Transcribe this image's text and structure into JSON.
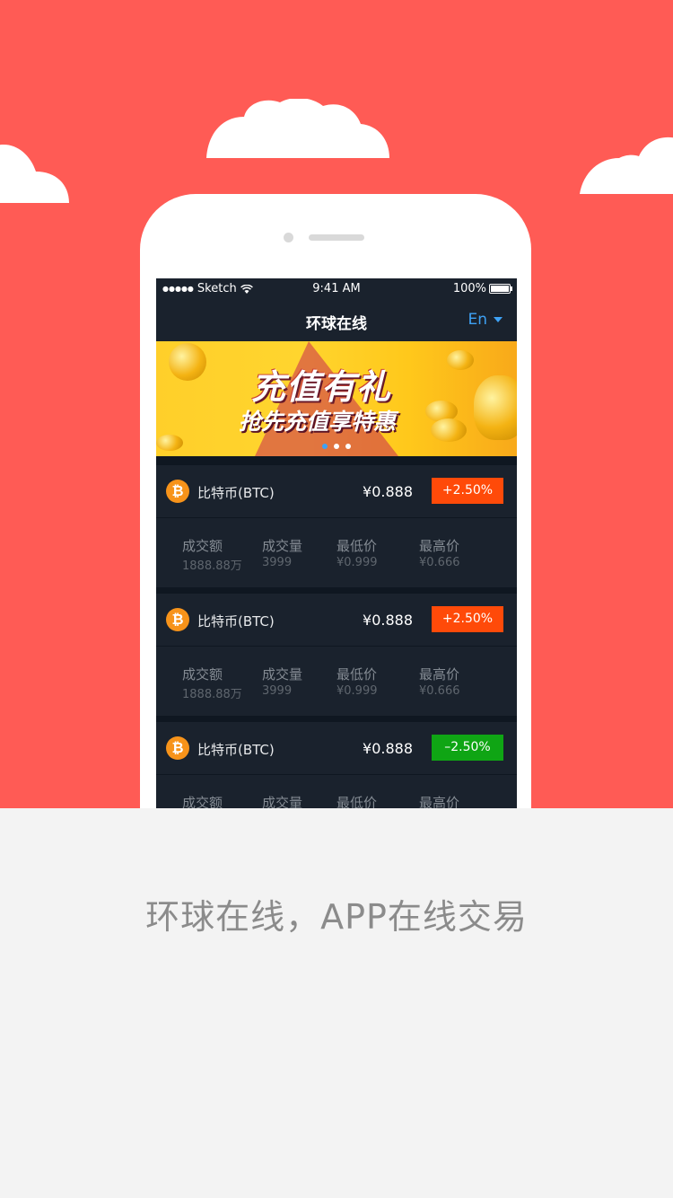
{
  "colors": {
    "background_red": "#ff5b55",
    "background_grey": "#f3f3f3",
    "screen_bg": "#0f1721",
    "card_bg": "#1a222d",
    "accent_blue": "#3ea2f5",
    "up_red": "#ff4a09",
    "down_green": "#0fa514",
    "btc_orange": "#f7931a"
  },
  "status_bar": {
    "signal_dots": "●●●●●",
    "carrier": "Sketch",
    "time": "9:41 AM",
    "battery": "100%"
  },
  "nav": {
    "title": "环球在线",
    "language": "En"
  },
  "banner": {
    "headline": "充值有礼",
    "subline": "抢先充值享特惠",
    "slides_count": 3,
    "active_slide": 1
  },
  "coins": [
    {
      "icon": "bitcoin-icon",
      "name": "比特币(BTC)",
      "price": "¥0.888",
      "change": "+2.50%",
      "direction": "up",
      "stats": [
        {
          "label": "成交额",
          "value": "1888.88万"
        },
        {
          "label": "成交量",
          "value": "3999"
        },
        {
          "label": "最低价",
          "value": "¥0.999"
        },
        {
          "label": "最高价",
          "value": "¥0.666"
        }
      ]
    },
    {
      "icon": "bitcoin-icon",
      "name": "比特币(BTC)",
      "price": "¥0.888",
      "change": "+2.50%",
      "direction": "up",
      "stats": [
        {
          "label": "成交额",
          "value": "1888.88万"
        },
        {
          "label": "成交量",
          "value": "3999"
        },
        {
          "label": "最低价",
          "value": "¥0.999"
        },
        {
          "label": "最高价",
          "value": "¥0.666"
        }
      ]
    },
    {
      "icon": "bitcoin-icon",
      "name": "比特币(BTC)",
      "price": "¥0.888",
      "change": "–2.50%",
      "direction": "down",
      "stats": [
        {
          "label": "成交额",
          "value": ""
        },
        {
          "label": "成交量",
          "value": ""
        },
        {
          "label": "最低价",
          "value": ""
        },
        {
          "label": "最高价",
          "value": ""
        }
      ]
    }
  ],
  "caption": "环球在线，APP在线交易"
}
